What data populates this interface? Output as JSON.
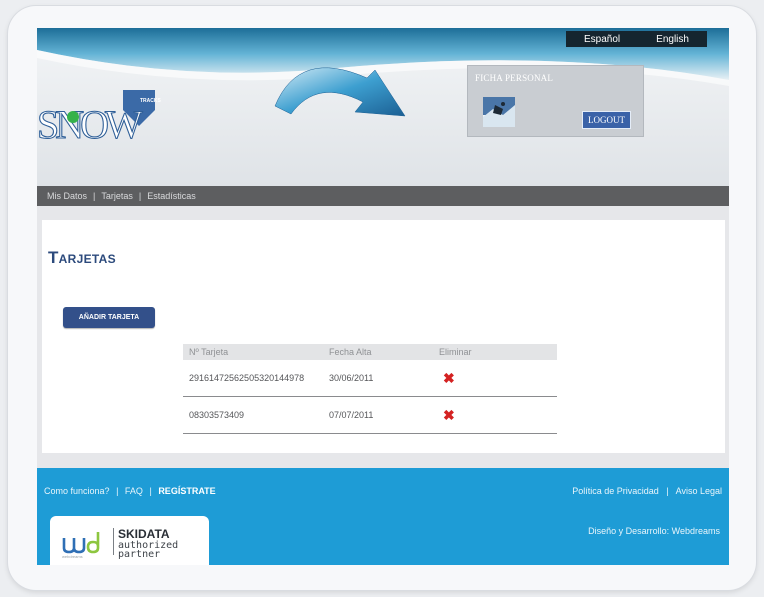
{
  "header": {
    "languages": [
      "Español",
      "English"
    ],
    "logo_text": "SNOW",
    "logo_badge": "TRACKS",
    "profile": {
      "title": "FICHA PERSONAL",
      "logout_label": "LOGOUT"
    }
  },
  "nav": {
    "items": [
      "Mis Datos",
      "Tarjetas",
      "Estadísticas"
    ],
    "separator": "|"
  },
  "main": {
    "title": "Tarjetas",
    "add_button_label": "AÑADIR TARJETA",
    "table": {
      "columns": [
        "Nº Tarjeta",
        "Fecha Alta",
        "Eliminar"
      ],
      "rows": [
        {
          "card": "29161472562505320144978",
          "date": "30/06/2011"
        },
        {
          "card": "08303573409",
          "date": "07/07/2011"
        }
      ]
    }
  },
  "footer": {
    "left_links": [
      "Como funciona?",
      "FAQ",
      "REGÍSTRATE"
    ],
    "right_links": [
      "Política de Privacidad",
      "Aviso Legal"
    ],
    "separator": "|",
    "credits": "Diseño y Desarrollo: Webdreams",
    "partner": {
      "wd_tagline": "webdreams",
      "brand": "SKIDATA",
      "subtitle_1": "authorized",
      "subtitle_2": "partner"
    }
  },
  "colors": {
    "brand_blue": "#2c4a7c",
    "button_blue": "#33508a",
    "footer_blue": "#1e9cd6",
    "nav_gray": "#5d5e60",
    "delete_red": "#d42222"
  }
}
